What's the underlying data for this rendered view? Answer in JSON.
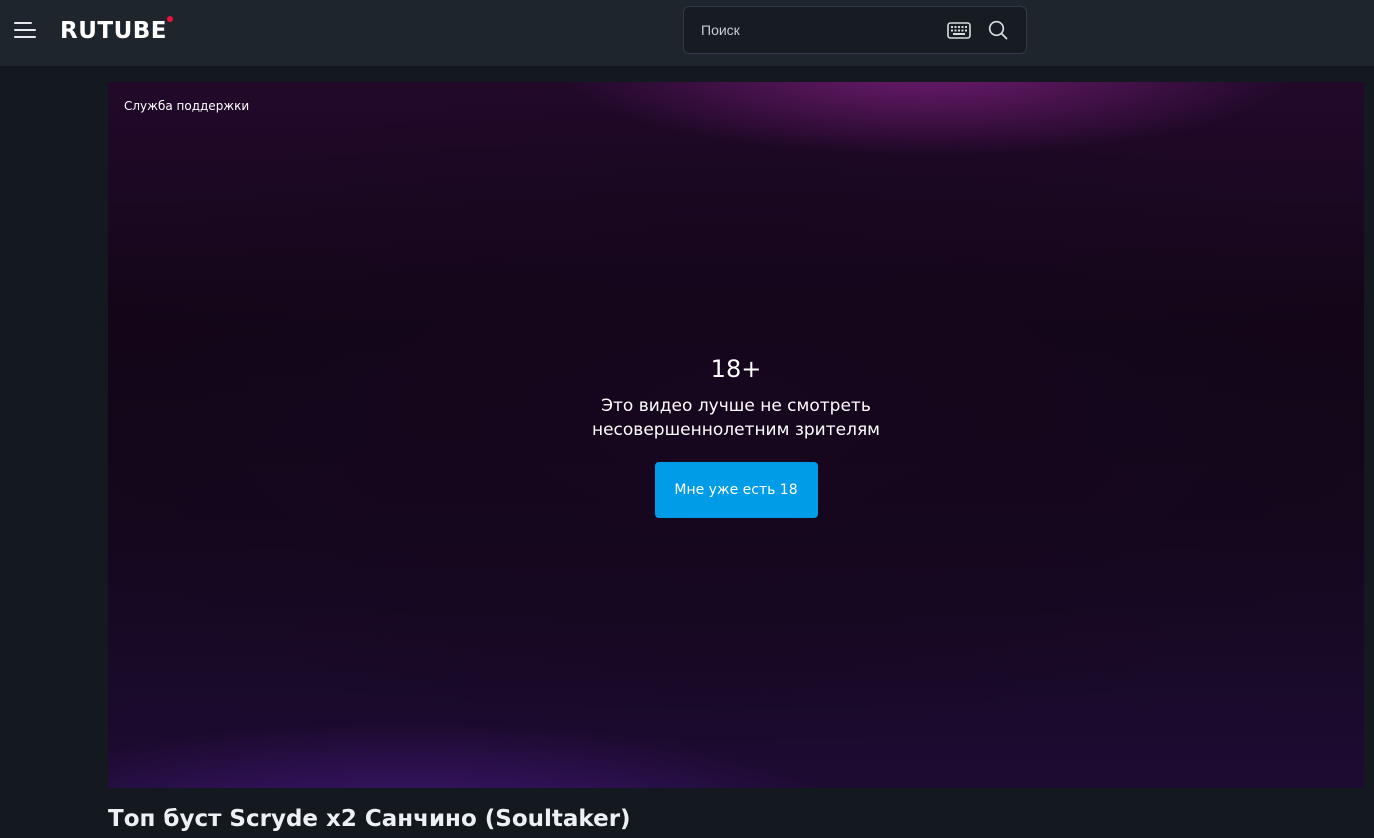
{
  "header": {
    "logo_text": "RUTUBE",
    "search": {
      "placeholder": "Поиск",
      "value": ""
    },
    "icons": [
      "menu-icon",
      "keyboard-icon",
      "search-icon"
    ]
  },
  "player": {
    "support_link": "Служба поддержки",
    "age_gate": {
      "title": "18+",
      "line1": "Это видео лучше не смотреть",
      "line2": "несовершеннолетним зрителям",
      "button_label": "Мне уже есть 18"
    }
  },
  "video": {
    "title": "Топ буст Scryde x2 Санчино (Soultaker)"
  },
  "colors": {
    "header_bg": "#1e252d",
    "page_bg": "#14191f",
    "accent_button": "#009ce8",
    "logo_dot": "#ed143b"
  }
}
